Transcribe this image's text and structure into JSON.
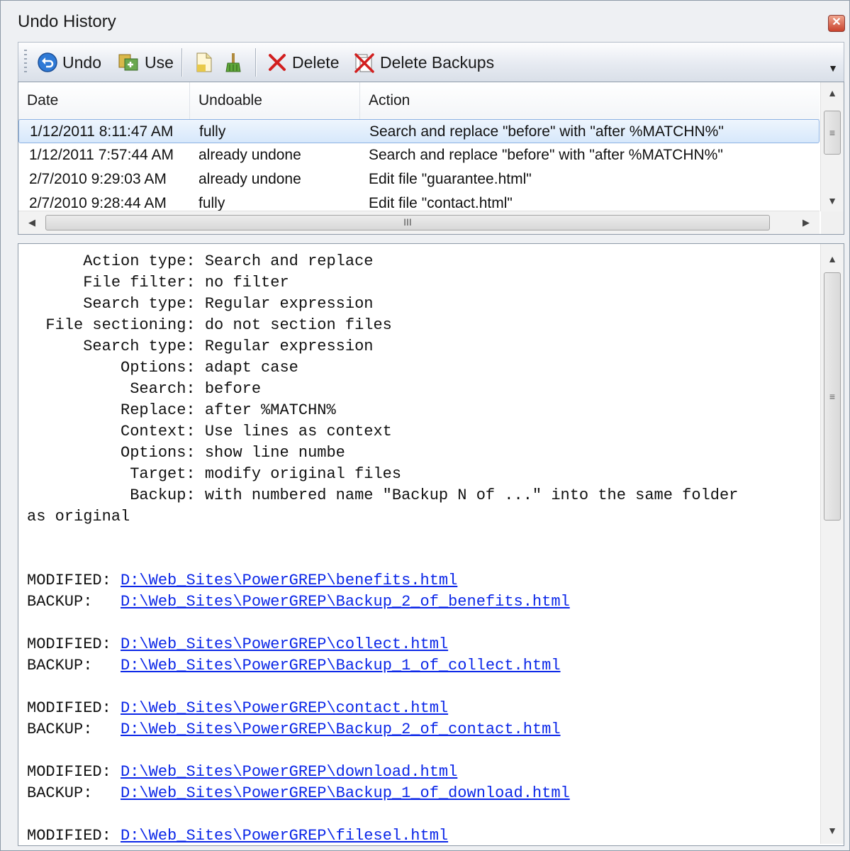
{
  "window": {
    "title": "Undo History"
  },
  "toolbar": {
    "undo_label": "Undo",
    "use_label": "Use",
    "delete_label": "Delete",
    "delete_backups_label": "Delete Backups"
  },
  "list": {
    "columns": [
      "Date",
      "Undoable",
      "Action"
    ],
    "rows": [
      {
        "date": "1/12/2011 8:11:47 AM",
        "undoable": "fully",
        "action": "Search and replace \"before\" with \"after %MATCHN%\""
      },
      {
        "date": "1/12/2011 7:57:44 AM",
        "undoable": "already undone",
        "action": "Search and replace \"before\" with \"after %MATCHN%\""
      },
      {
        "date": "2/7/2010 9:29:03 AM",
        "undoable": "already undone",
        "action": "Edit file \"guarantee.html\""
      },
      {
        "date": "2/7/2010 9:28:44 AM",
        "undoable": "fully",
        "action": "Edit file \"contact.html\""
      }
    ],
    "hscroll_grip": "III",
    "vscroll_grip": "≡"
  },
  "details": {
    "lines": [
      "      Action type: Search and replace",
      "      File filter: no filter",
      "      Search type: Regular expression",
      "  File sectioning: do not section files",
      "      Search type: Regular expression",
      "          Options: adapt case",
      "           Search: before",
      "          Replace: after %MATCHN%",
      "          Context: Use lines as context",
      "          Options: show line numbe",
      "           Target: modify original files",
      "           Backup: with numbered name \"Backup N of ...\" into the same folder",
      "as original"
    ],
    "files": [
      {
        "modified_label": "MODIFIED: ",
        "modified": "D:\\Web_Sites\\PowerGREP\\benefits.html",
        "backup_label": "BACKUP:   ",
        "backup": "D:\\Web_Sites\\PowerGREP\\Backup_2_of_benefits.html"
      },
      {
        "modified_label": "MODIFIED: ",
        "modified": "D:\\Web_Sites\\PowerGREP\\collect.html",
        "backup_label": "BACKUP:   ",
        "backup": "D:\\Web_Sites\\PowerGREP\\Backup_1_of_collect.html"
      },
      {
        "modified_label": "MODIFIED: ",
        "modified": "D:\\Web_Sites\\PowerGREP\\contact.html",
        "backup_label": "BACKUP:   ",
        "backup": "D:\\Web_Sites\\PowerGREP\\Backup_2_of_contact.html"
      },
      {
        "modified_label": "MODIFIED: ",
        "modified": "D:\\Web_Sites\\PowerGREP\\download.html",
        "backup_label": "BACKUP:   ",
        "backup": "D:\\Web_Sites\\PowerGREP\\Backup_1_of_download.html"
      }
    ],
    "partial_line_label": "MODIFIED: ",
    "partial_line_path": "D:\\Web_Sites\\PowerGREP\\filesel.html",
    "vscroll_grip": "≡"
  }
}
